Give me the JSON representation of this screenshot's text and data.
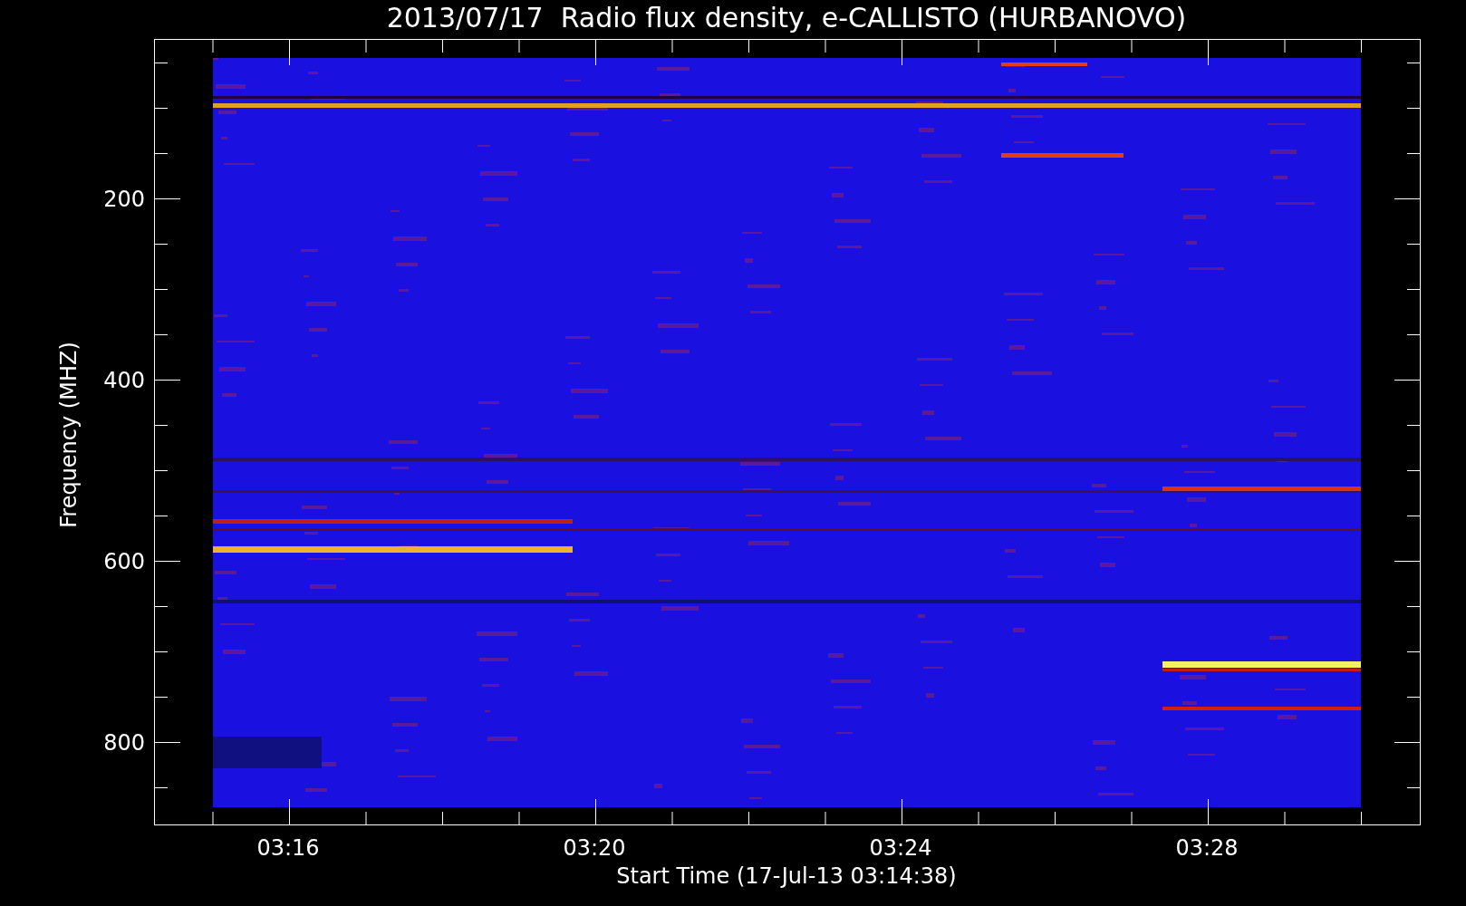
{
  "title": "2013/07/17  Radio flux density, e-CALLISTO (HURBANOVO)",
  "y_axis": {
    "label": "Frequency (MHZ)",
    "ticks": [
      "200",
      "400",
      "600",
      "800"
    ]
  },
  "x_axis": {
    "label": "Start Time (17-Jul-13 03:14:38)",
    "ticks": [
      "03:16",
      "03:20",
      "03:24",
      "03:28"
    ]
  }
}
